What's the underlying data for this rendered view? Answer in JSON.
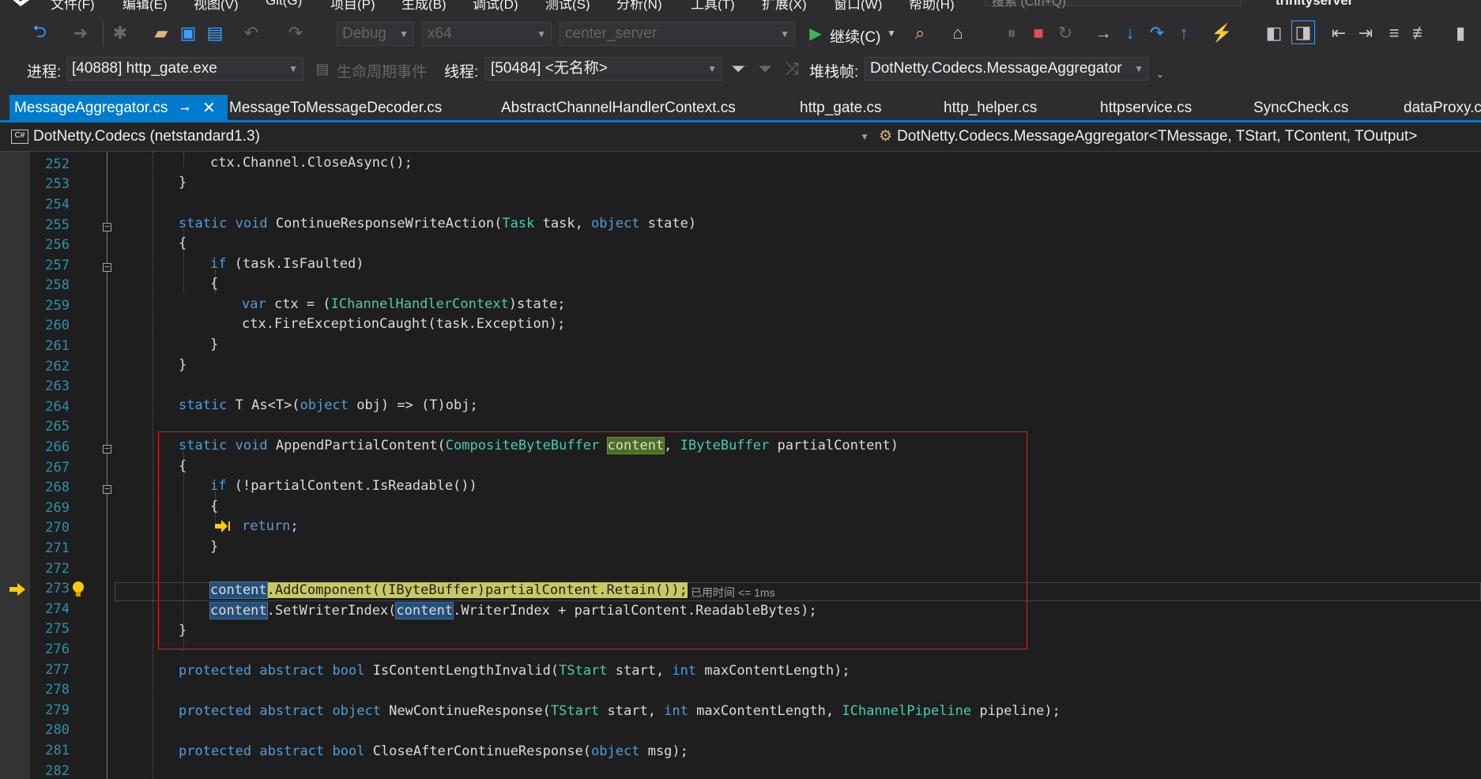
{
  "menu": [
    "文件(F)",
    "编辑(E)",
    "视图(V)",
    "Git(G)",
    "项目(P)",
    "生成(B)",
    "调试(D)",
    "测试(S)",
    "分析(N)",
    "工具(T)",
    "扩展(X)",
    "窗口(W)",
    "帮助(H)"
  ],
  "search_placeholder": "搜索 (Ctrl+Q)",
  "solution_name": "trinityserver",
  "toolbar": {
    "config": "Debug",
    "platform": "x64",
    "startup_project": "center_server",
    "continue_label": "继续(C)"
  },
  "debug_location": {
    "process_label": "进程:",
    "process": "[40888] http_gate.exe",
    "lifecycle_label": "生命周期事件",
    "thread_label": "线程:",
    "thread": "[50484] <无名称>",
    "stack_label": "堆栈帧:",
    "stack": "DotNetty.Codecs.MessageAggregator"
  },
  "tabs": [
    "MessageAggregator.cs",
    "MessageToMessageDecoder.cs",
    "AbstractChannelHandlerContext.cs",
    "http_gate.cs",
    "http_helper.cs",
    "httpservice.cs",
    "SyncCheck.cs",
    "dataProxy.c"
  ],
  "nav": {
    "project": "DotNetty.Codecs (netstandard1.3)",
    "type": "DotNetty.Codecs.MessageAggregator<TMessage, TStart, TContent, TOutput>"
  },
  "lines": [
    "252",
    "253",
    "254",
    "255",
    "256",
    "257",
    "258",
    "259",
    "260",
    "261",
    "262",
    "263",
    "264",
    "265",
    "266",
    "267",
    "268",
    "269",
    "270",
    "271",
    "272",
    "273",
    "274",
    "275",
    "276",
    "277",
    "278",
    "279",
    "280",
    "281",
    "282"
  ],
  "current_line": "273",
  "elapsed_hint": "已用时间 <= 1ms",
  "colors": {
    "accent": "#007acc",
    "keyword": "#569cd6",
    "type": "#4ec9b0",
    "linenum": "#2b91af",
    "breakbox": "#e02020"
  }
}
